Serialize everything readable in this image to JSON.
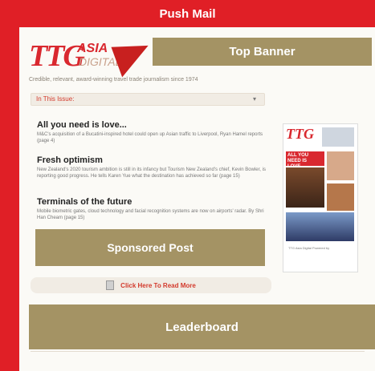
{
  "header": {
    "title": "Push Mail"
  },
  "logo": {
    "ttg": "TTG",
    "asia": "ASIA",
    "digital": "DIGITAL"
  },
  "tagline": "Credible, relevant, award-winning travel trade journalism since 1974",
  "placements": {
    "top_banner": "Top Banner",
    "sponsored_post": "Sponsored Post",
    "leaderboard": "Leaderboard"
  },
  "issue_bar": {
    "label": "In This Issue:",
    "chevron": "▾"
  },
  "articles": [
    {
      "title": "All you need is love...",
      "desc": "M&C's acquisition of a Bucatini-inspired hotel could open up Asian traffic to Liverpool, Ryan Hamel reports (page 4)"
    },
    {
      "title": "Fresh optimism",
      "desc": "New Zealand's 2020 tourism ambition is still in its infancy but Tourism New Zealand's chief, Kevin Bowler, is reporting good progress. He tells Karen Yue what the destination has achieved so far (page 15)"
    },
    {
      "title": "Terminals of the future",
      "desc": "Mobile biometric gates, cloud technology and facial recognition systems are now on airports' radar. By Shri Han Cheam (page 15)"
    }
  ],
  "thumbnail": {
    "logo": "TTG",
    "headline": "ALL YOU NEED IS LOVE...",
    "footer": "TTG Asia Digital Powered by"
  },
  "read_more": "Click Here To Read More",
  "colors": {
    "frame": "#e01f26",
    "placeholder": "#a49364",
    "link": "#d33a2c"
  }
}
